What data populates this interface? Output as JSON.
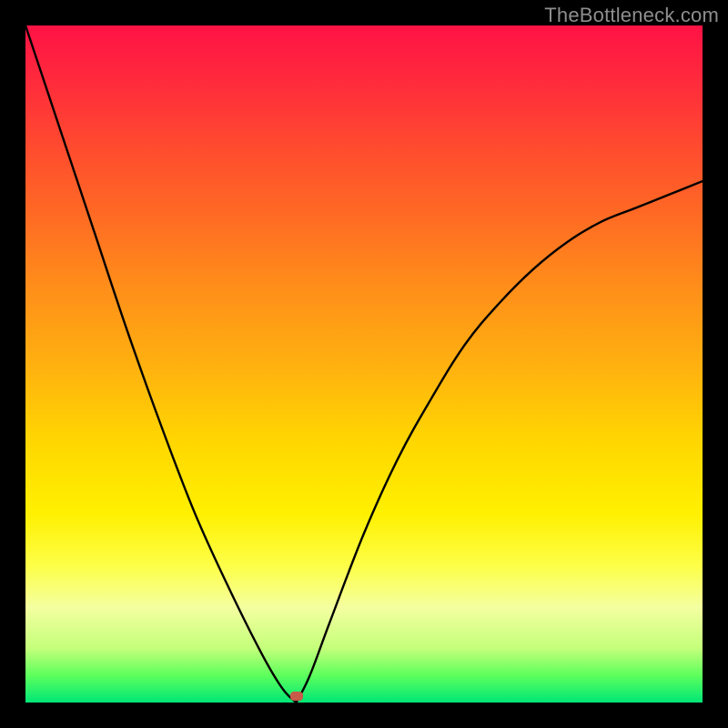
{
  "watermark": "TheBottleneck.com",
  "colors": {
    "frame": "#000000",
    "curve": "#000000",
    "dot": "#c85a4a",
    "gradient_top": "#ff1245",
    "gradient_bottom": "#00e676"
  },
  "chart_data": {
    "type": "line",
    "title": "",
    "xlabel": "",
    "ylabel": "",
    "xlim": [
      0,
      10
    ],
    "ylim": [
      0,
      100
    ],
    "grid": false,
    "legend": false,
    "cusp_x": 4.0,
    "marker": {
      "x": 4.0,
      "y": 0
    },
    "series": [
      {
        "name": "curve",
        "x": [
          0.0,
          0.5,
          1.0,
          1.5,
          2.0,
          2.5,
          3.0,
          3.5,
          3.8,
          4.0,
          4.2,
          4.5,
          5.0,
          5.5,
          6.0,
          6.5,
          7.0,
          7.5,
          8.0,
          8.5,
          9.0,
          9.5,
          10.0
        ],
        "y": [
          100,
          85,
          70,
          55,
          41,
          28,
          17,
          7,
          2,
          0,
          4,
          12,
          25,
          36,
          45,
          53,
          59,
          64,
          68,
          71,
          73,
          75,
          77
        ]
      }
    ]
  }
}
